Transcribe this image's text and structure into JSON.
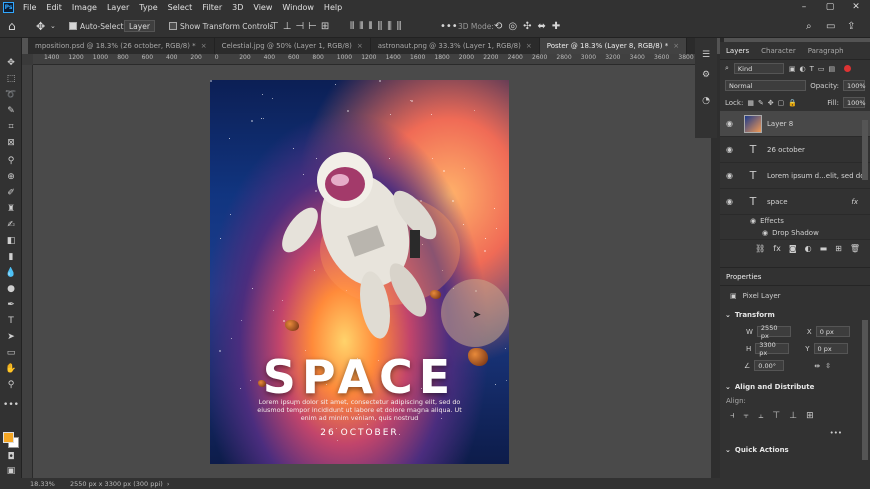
{
  "menubar": {
    "logo": "Ps",
    "items": [
      "File",
      "Edit",
      "Image",
      "Layer",
      "Type",
      "Select",
      "Filter",
      "3D",
      "View",
      "Window",
      "Help"
    ],
    "window_controls": [
      "–",
      "▢",
      "✕"
    ]
  },
  "options_bar": {
    "auto_select_label": "Auto-Select:",
    "auto_select_checked": true,
    "auto_select_target": "Layer",
    "transform_controls_label": "Show Transform Controls",
    "mode_3d_label": "3D Mode:"
  },
  "doc_tabs": [
    {
      "label": "mposition.psd @ 18.3% (26 october, RGB/8) *",
      "active": false
    },
    {
      "label": "Celestial.jpg @ 50% (Layer 1, RGB/8)",
      "active": false
    },
    {
      "label": "astronaut.png @ 33.3% (Layer 1, RGB/8)",
      "active": false
    },
    {
      "label": "Poster @ 18.3% (Layer 8, RGB/8) *",
      "active": true
    }
  ],
  "ruler": {
    "labels": [
      "1400",
      "1200",
      "1000",
      "800",
      "600",
      "400",
      "200",
      "0",
      "200",
      "400",
      "600",
      "800",
      "1000",
      "1200",
      "1400",
      "1600",
      "1800",
      "2000",
      "2200",
      "2400",
      "2600",
      "2800",
      "3000",
      "3200",
      "3400",
      "3600",
      "3800",
      "4000"
    ]
  },
  "canvas": {
    "title": "SPACE",
    "body": "Lorem ipsum dolor sit amet, consectetur adipiscing elit, sed do eiusmod tempor incididunt ut labore et dolore magna aliqua. Ut enim ad minim veniam, quis nostrud",
    "date": "26 OCTOBER"
  },
  "layers_panel": {
    "tabs": [
      "Layers",
      "Character",
      "Paragraph"
    ],
    "filter": "Kind",
    "blend_mode": "Normal",
    "opacity_label": "Opacity:",
    "opacity_value": "100%",
    "lock_label": "Lock:",
    "fill_label": "Fill:",
    "fill_value": "100%",
    "layers": [
      {
        "name": "Layer 8",
        "type": "image",
        "selected": true
      },
      {
        "name": "26 october",
        "type": "text",
        "selected": false
      },
      {
        "name": "Lorem ipsum d...elit, sed do",
        "type": "text",
        "selected": false
      },
      {
        "name": "space",
        "type": "text",
        "selected": false,
        "fx": "fx"
      }
    ],
    "effects_label": "Effects",
    "drop_shadow_label": "Drop Shadow"
  },
  "properties_panel": {
    "tab": "Properties",
    "kind": "Pixel Layer",
    "transform_header": "Transform",
    "w_label": "W",
    "w_value": "2550 px",
    "h_label": "H",
    "h_value": "3300 px",
    "x_label": "X",
    "x_value": "0 px",
    "y_label": "Y",
    "y_value": "0 px",
    "angle_value": "0.00°",
    "align_header": "Align and Distribute",
    "align_label": "Align:",
    "quick_actions_header": "Quick Actions",
    "more": "•••"
  },
  "status": {
    "zoom": "18.33%",
    "doc_info": "2550 px x 3300 px (300 ppi)"
  },
  "colors": {
    "foreground": "#f5a623",
    "background": "#ffffff",
    "accent": "#31a8ff"
  }
}
